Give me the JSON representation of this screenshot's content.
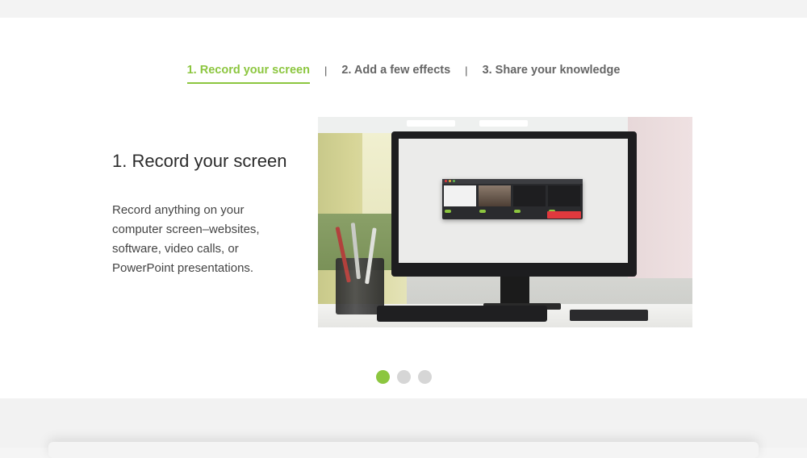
{
  "tabs": [
    {
      "label": "1. Record your screen",
      "active": true
    },
    {
      "label": "2. Add a few effects",
      "active": false
    },
    {
      "label": "3. Share your knowledge",
      "active": false
    }
  ],
  "tab_separator": "|",
  "slide": {
    "title": "1. Record your screen",
    "description": "Record anything on your computer screen–websites, software, video calls, or PowerPoint presentations.",
    "image_icon": "desktop-computer-photo"
  },
  "pager": {
    "count": 3,
    "active_index": 0
  },
  "colors": {
    "accent": "#8cc63f",
    "tab_text": "#666666",
    "dot_inactive": "#d6d6d6",
    "record_button": "#e0393e"
  }
}
